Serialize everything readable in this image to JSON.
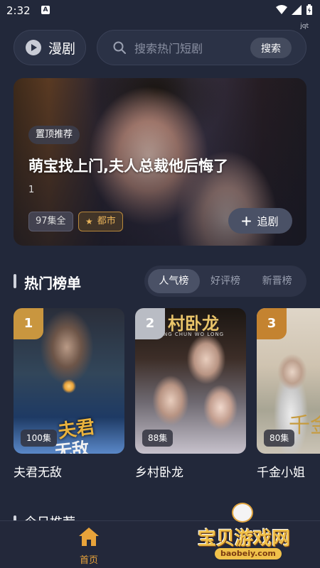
{
  "status": {
    "time": "2:32",
    "carrier": "jqt"
  },
  "header": {
    "drama_label": "漫剧",
    "search_placeholder": "搜索热门短剧",
    "search_button": "搜索"
  },
  "banner": {
    "tag": "置顶推荐",
    "title": "萌宝找上门,夫人总裁他后悔了",
    "desc": "1",
    "episodes": "97集全",
    "genre": "都市",
    "follow_label": "追剧"
  },
  "hot_section": {
    "title": "热门榜单",
    "tabs": [
      {
        "label": "人气榜",
        "active": true
      },
      {
        "label": "好评榜",
        "active": false
      },
      {
        "label": "新晋榜",
        "active": false
      }
    ],
    "items": [
      {
        "rank": "1",
        "title": "夫君无敌",
        "episodes": "100集",
        "poster_text_1": "夫君",
        "poster_text_2": "无敌"
      },
      {
        "rank": "2",
        "title": "乡村卧龙",
        "episodes": "88集",
        "poster_title": "村卧龙",
        "poster_sub": "NG CHUN WO LONG"
      },
      {
        "rank": "3",
        "title": "千金小姐",
        "episodes": "80集",
        "poster_text": "千金"
      }
    ]
  },
  "next_section": {
    "title": "今日推荐"
  },
  "bottom_nav": {
    "home_label": "首页",
    "active_color": "#e8a33a"
  },
  "watermark": {
    "text": "宝贝游戏网",
    "url": "baobeiy.com"
  },
  "colors": {
    "background": "#22283a",
    "accent": "#e8a33a",
    "gold": "#c9963f"
  }
}
